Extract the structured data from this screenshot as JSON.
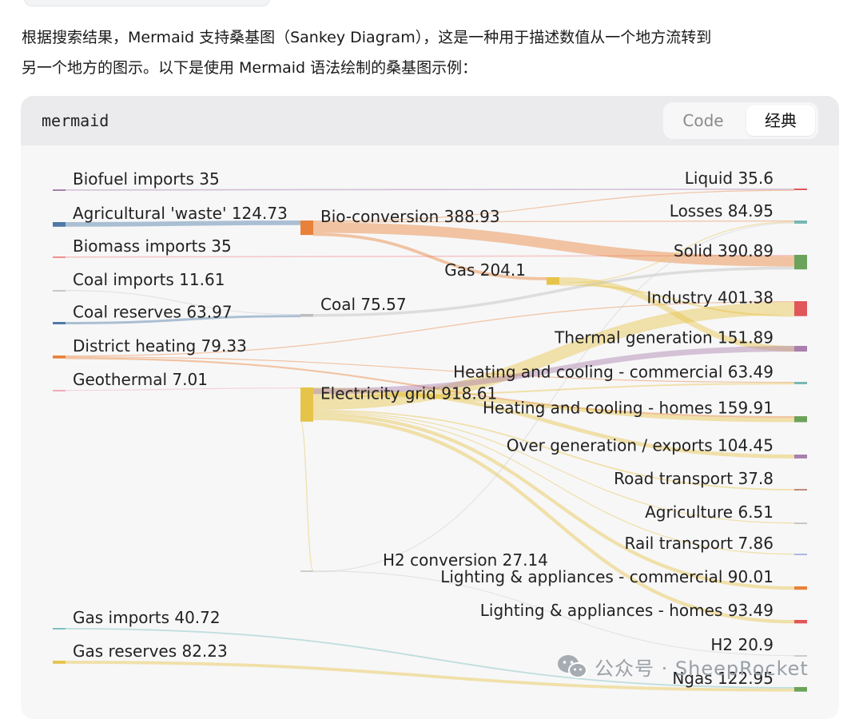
{
  "intro": {
    "line1": "根据搜索结果，Mermaid 支持桑基图（Sankey Diagram），这是一种用于描述数值从一个地方流转到",
    "line2": "另一个地方的图示。以下是使用 Mermaid 语法绘制的桑基图示例："
  },
  "code_block": {
    "language": "mermaid",
    "tabs": [
      {
        "label": "Code",
        "active": false
      },
      {
        "label": "经典",
        "active": true
      }
    ]
  },
  "watermark": {
    "text": "公众号 · SheepRocket",
    "icon": "wechat-icon"
  },
  "chart_data": {
    "type": "sankey",
    "nodes": [
      {
        "id": "biofuel",
        "name": "Biofuel imports",
        "value": 35,
        "color": "#a97fae"
      },
      {
        "id": "agri_waste",
        "name": "Agricultural 'waste'",
        "value": 124.73,
        "color": "#4e79a7"
      },
      {
        "id": "biomass",
        "name": "Biomass imports",
        "value": 35,
        "color": "#f28e8e"
      },
      {
        "id": "coal_imp",
        "name": "Coal imports",
        "value": 11.61,
        "color": "#c7c7c7"
      },
      {
        "id": "coal_res",
        "name": "Coal reserves",
        "value": 63.97,
        "color": "#4e79a7"
      },
      {
        "id": "district",
        "name": "District heating",
        "value": 79.33,
        "color": "#e8823a"
      },
      {
        "id": "geothermal",
        "name": "Geothermal",
        "value": 7.01,
        "color": "#f2a9b8"
      },
      {
        "id": "gas_imp",
        "name": "Gas imports",
        "value": 40.72,
        "color": "#7fbfbf"
      },
      {
        "id": "gas_res",
        "name": "Gas reserves",
        "value": 82.23,
        "color": "#e6c44a"
      },
      {
        "id": "bioconv",
        "name": "Bio-conversion",
        "value": 388.93,
        "color": "#e8823a"
      },
      {
        "id": "coal",
        "name": "Coal",
        "value": 75.57,
        "color": "#bdbdbd"
      },
      {
        "id": "elec",
        "name": "Electricity grid",
        "value": 918.61,
        "color": "#e6c44a"
      },
      {
        "id": "h2conv",
        "name": "H2 conversion",
        "value": 27.14,
        "color": "#cccccc"
      },
      {
        "id": "gas",
        "name": "Gas",
        "value": 204.1,
        "color": "#e6c44a"
      },
      {
        "id": "liquid",
        "name": "Liquid",
        "value": 35.6,
        "color": "#e15759"
      },
      {
        "id": "losses",
        "name": "Losses",
        "value": 84.95,
        "color": "#76b7b2"
      },
      {
        "id": "solid",
        "name": "Solid",
        "value": 390.89,
        "color": "#6ca35a"
      },
      {
        "id": "industry",
        "name": "Industry",
        "value": 401.38,
        "color": "#e15759"
      },
      {
        "id": "thermal",
        "name": "Thermal generation",
        "value": 151.89,
        "color": "#a97fae"
      },
      {
        "id": "hc_comm",
        "name": "Heating and cooling - commercial",
        "value": 63.49,
        "color": "#76b7b2"
      },
      {
        "id": "hc_homes",
        "name": "Heating and cooling - homes",
        "value": 159.91,
        "color": "#6ca35a"
      },
      {
        "id": "overgen",
        "name": "Over generation / exports",
        "value": 104.45,
        "color": "#a97fae"
      },
      {
        "id": "road",
        "name": "Road transport",
        "value": 37.8,
        "color": "#c08a7a"
      },
      {
        "id": "agriculture",
        "name": "Agriculture",
        "value": 6.51,
        "color": "#c7c7c7"
      },
      {
        "id": "rail",
        "name": "Rail transport",
        "value": 7.86,
        "color": "#a9b8e0"
      },
      {
        "id": "la_comm",
        "name": "Lighting & appliances - commercial",
        "value": 90.01,
        "color": "#e8823a"
      },
      {
        "id": "la_homes",
        "name": "Lighting & appliances - homes",
        "value": 93.49,
        "color": "#e15759"
      },
      {
        "id": "h2",
        "name": "H2",
        "value": 20.9,
        "color": "#cccccc"
      },
      {
        "id": "ngas",
        "name": "Ngas",
        "value": 122.95,
        "color": "#6ca35a"
      }
    ],
    "links": [
      [
        "biofuel",
        "liquid",
        35
      ],
      [
        "agri_waste",
        "bioconv",
        124.73
      ],
      [
        "biomass",
        "solid",
        35
      ],
      [
        "coal_imp",
        "coal",
        11.61
      ],
      [
        "coal_res",
        "coal",
        63.97
      ],
      [
        "district",
        "industry",
        10.64
      ],
      [
        "district",
        "hc_comm",
        22.505
      ],
      [
        "district",
        "hc_homes",
        46.184
      ],
      [
        "geothermal",
        "elec",
        7.013
      ],
      [
        "gas_imp",
        "ngas",
        40.719
      ],
      [
        "gas_res",
        "ngas",
        82.233
      ],
      [
        "bioconv",
        "liquid",
        0.597
      ],
      [
        "bioconv",
        "losses",
        26.862
      ],
      [
        "bioconv",
        "solid",
        280.322
      ],
      [
        "bioconv",
        "gas",
        81.144
      ],
      [
        "coal",
        "solid",
        75.571
      ],
      [
        "elec",
        "overgen",
        104.453
      ],
      [
        "elec",
        "hc_homes",
        113.726
      ],
      [
        "elec",
        "hc_comm",
        40.719
      ],
      [
        "elec",
        "industry",
        342.165
      ],
      [
        "elec",
        "road",
        37.797
      ],
      [
        "elec",
        "agriculture",
        4.412
      ],
      [
        "elec",
        "rail",
        7.863
      ],
      [
        "elec",
        "la_comm",
        90.008
      ],
      [
        "elec",
        "la_homes",
        93.494
      ],
      [
        "elec",
        "h2conv",
        27.14
      ],
      [
        "gas",
        "thermal",
        151.891
      ],
      [
        "gas",
        "losses",
        3.818
      ],
      [
        "gas",
        "industry",
        48.58
      ],
      [
        "h2conv",
        "h2",
        20.897
      ],
      [
        "h2conv",
        "losses",
        6.242
      ],
      [
        "thermal",
        "elec",
        151.891
      ]
    ]
  }
}
